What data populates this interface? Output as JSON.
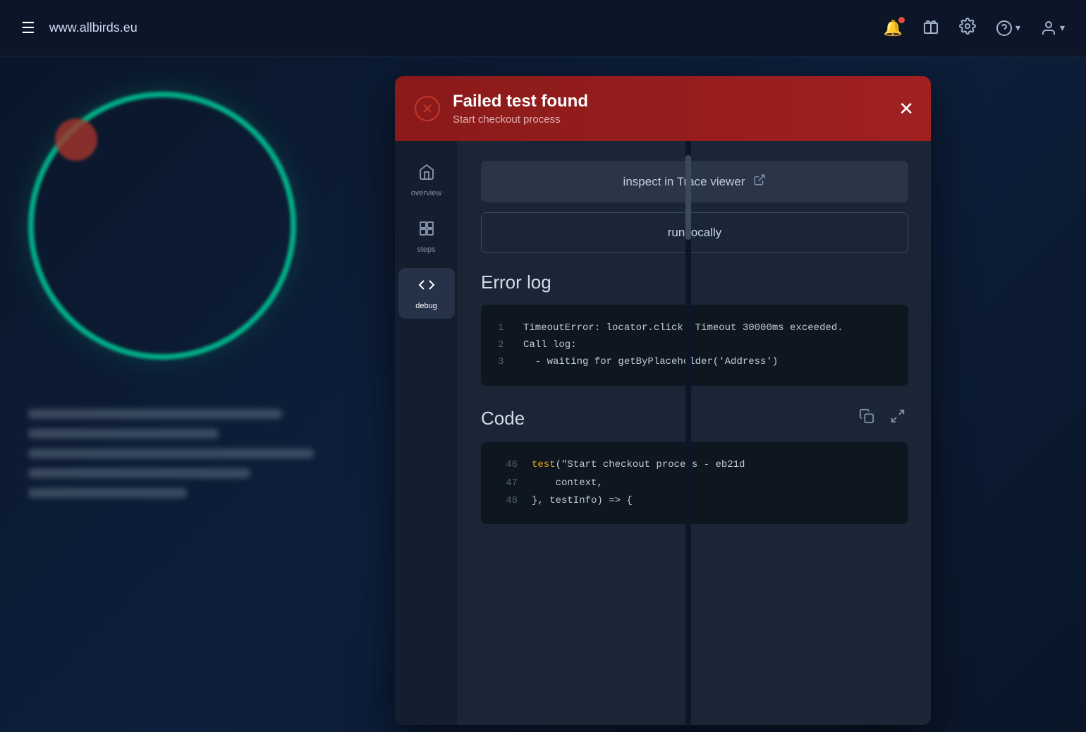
{
  "topbar": {
    "url": "www.allbirds.eu",
    "hamburger_label": "☰"
  },
  "icons": {
    "hamburger": "☰",
    "bell": "🔔",
    "gift": "🎁",
    "gear": "⚙",
    "help": "?",
    "user": "👤",
    "chevron_down": "▾",
    "close": "✕",
    "error_circle": "✕",
    "external_link": "↗",
    "copy": "⧉",
    "expand": "⤢",
    "home": "⌂",
    "steps": "▣▣"
  },
  "modal": {
    "header": {
      "title": "Failed test found",
      "subtitle": "Start checkout process"
    },
    "sidebar": {
      "items": [
        {
          "id": "overview",
          "label": "overview",
          "active": false
        },
        {
          "id": "steps",
          "label": "steps",
          "active": false
        },
        {
          "id": "debug",
          "label": "debug",
          "active": true
        }
      ]
    },
    "buttons": {
      "inspect_label": "inspect in Trace viewer",
      "run_locally_label": "run locally"
    },
    "error_log": {
      "title": "Error log",
      "lines": [
        {
          "num": "1",
          "text": "TimeoutError: locator.click: Timeout 30000ms exceeded."
        },
        {
          "num": "2",
          "text": "Call log:"
        },
        {
          "num": "3",
          "text": "  - waiting for getByPlaceholder('Address')"
        }
      ]
    },
    "code": {
      "title": "Code",
      "lines": [
        {
          "num": "46",
          "text": "test(\"Start checkout process - eb21d",
          "type": "keyword_start"
        },
        {
          "num": "47",
          "text": "    context,",
          "type": "normal"
        },
        {
          "num": "48",
          "text": "}, testInfo) => {",
          "type": "normal"
        }
      ]
    }
  }
}
